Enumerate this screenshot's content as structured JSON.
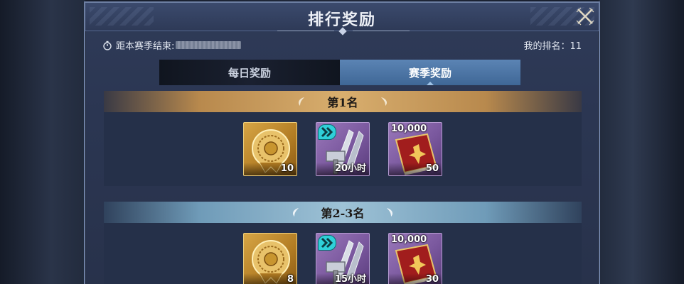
{
  "dialog": {
    "title": "排行奖励"
  },
  "season": {
    "countdown_label": "距本赛季结束:",
    "my_rank_label": "我的排名：",
    "my_rank_value": "11"
  },
  "tabs": [
    {
      "label": "每日奖励",
      "active": false
    },
    {
      "label": "赛季奖励",
      "active": true
    }
  ],
  "tiers": [
    {
      "label": "第1名",
      "style": "gold",
      "rewards": [
        {
          "icon": "gold-medal-icon",
          "quantity": "10"
        },
        {
          "icon": "hammer-speedup-icon",
          "quantity": "20小时"
        },
        {
          "icon": "red-book-icon",
          "top_value": "10,000",
          "quantity": "50"
        }
      ]
    },
    {
      "label": "第2-3名",
      "style": "blue",
      "rewards": [
        {
          "icon": "gold-medal-icon",
          "quantity": "8"
        },
        {
          "icon": "hammer-speedup-icon",
          "quantity": "15小时"
        },
        {
          "icon": "red-book-icon",
          "top_value": "10,000",
          "quantity": "30"
        }
      ]
    }
  ],
  "colors": {
    "panel": "#2b3652",
    "gold_header": "#d8ae6e",
    "blue_header": "#9ec2d6",
    "active_tab": "#4d76a6"
  }
}
